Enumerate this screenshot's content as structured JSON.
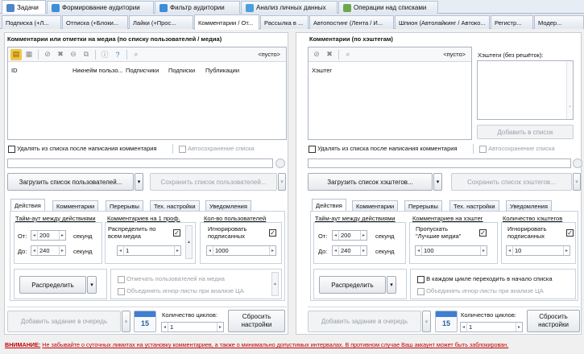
{
  "top_tabs": [
    {
      "label": "Задачи",
      "color": "#4f86c6"
    },
    {
      "label": "Формирование аудитории",
      "color": "#3d8ed8"
    },
    {
      "label": "Фильтр аудитории",
      "color": "#3d8ed8"
    },
    {
      "label": "Анализ личных данных",
      "color": "#4aa0d8"
    },
    {
      "label": "Операции над списками",
      "color": "#6aa84f"
    }
  ],
  "sub_tabs": [
    "Подписка (+Л...",
    "Отписка (+Блоки...",
    "Лайки (+Прос...",
    "Комментарии / От...",
    "Рассылка в ...",
    "Автопостинг (Лента / И...",
    "Шпион (Автолайкинг / Автоко...",
    "Регистр...",
    "Модер..."
  ],
  "left": {
    "title": "Комментарии или отметки на медиа (по списку пользователей / медиа)",
    "empty_label": "<пусто>",
    "columns": [
      "ID",
      "Никнейм пользо...",
      "Подписчики",
      "Подписки",
      "Публикации"
    ],
    "delete_after": "Удалять из списка после написания комментария",
    "autosave": "Автосохранение списка",
    "load_btn": "Загрузить список пользователей...",
    "save_btn": "Сохранить список пользователей...",
    "tabs": [
      "Действия",
      "Комментарии",
      "Перерывы",
      "Тех. настройки",
      "Уведомления"
    ],
    "timeout_hdr": "Тайм-аут между действиями",
    "from_label": "От:",
    "from_val": "200",
    "to_label": "До:",
    "to_val": "240",
    "sec": "секунд",
    "per_prof_hdr": "Комментариев на 1 проф.",
    "distribute_all": "Распределить по всем медиа",
    "per_prof_val": "1",
    "users_hdr": "Кол-во пользователей",
    "ignore_subs": "Игнорировать подписанных",
    "users_val": "1000",
    "distribute_btn": "Распределить",
    "mark_users": "Отмечать пользователей на медиа",
    "merge_ignore": "Объединять игнор-листы при анализе ЦА",
    "queue_btn": "Добавить задание в очередь",
    "cycles_label": "Количество циклов:",
    "cycles_val": "1",
    "reset_btn": "Сбросить настройки",
    "cal_day": "15"
  },
  "right": {
    "title": "Комментарии (по хэштегам)",
    "empty_label": "<пусто>",
    "column": "Хэштег",
    "side_label": "Хэштеги (без решёток):",
    "add_btn": "Добавить в список",
    "delete_after": "Удалять из списка после написания комментария",
    "autosave": "Автосохранение списка",
    "load_btn": "Загрузить список хэштегов...",
    "save_btn": "Сохранить список хэштегов...",
    "tabs": [
      "Действия",
      "Комментарии",
      "Перерывы",
      "Тех. настройки",
      "Уведомления"
    ],
    "timeout_hdr": "Тайм-аут между действиями",
    "from_label": "От:",
    "from_val": "200",
    "to_label": "До:",
    "to_val": "240",
    "sec": "секунд",
    "per_tag_hdr": "Комментариев на хэштег",
    "skip_best": "Пропускать \"Лучшие медиа\"",
    "per_tag_val": "100",
    "count_hdr": "Количество хэштегов",
    "ignore_subs": "Игнорировать подписанных",
    "count_val": "10",
    "distribute_btn": "Распределить",
    "restart": "В каждом цикле переходить в начало списка",
    "merge_ignore": "Объединять игнор-листы при анализе ЦА",
    "queue_btn": "Добавить задание в очередь",
    "cycles_label": "Количество циклов:",
    "cycles_val": "1",
    "reset_btn": "Сбросить настройки",
    "cal_day": "15"
  },
  "warning": {
    "prefix": "ВНИМАНИЕ:",
    "text": "Не забывайте о суточных лимитах на установку комментариев, а также о минимально допустимых интервалах. В противном случае Ваш аккаунт может быть заблокирован."
  }
}
